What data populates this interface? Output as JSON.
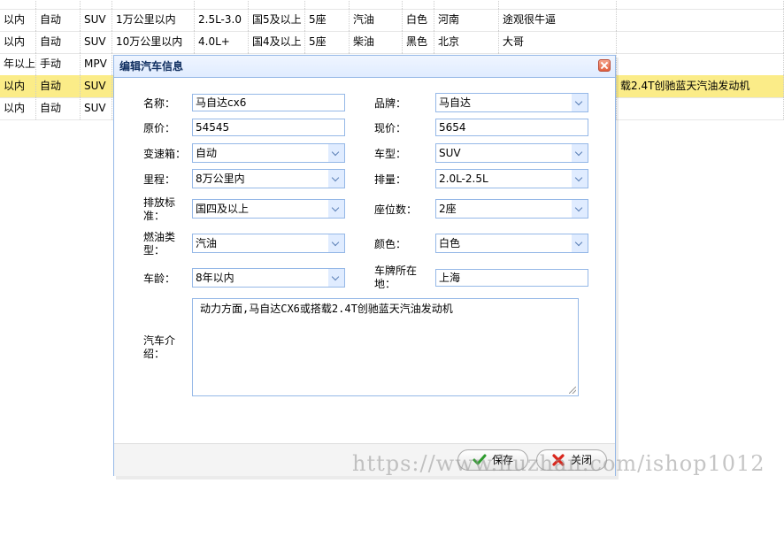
{
  "grid": {
    "rows": [
      {
        "cells": [
          "",
          "",
          "",
          "",
          "",
          "",
          "",
          "",
          "",
          "",
          "",
          ""
        ],
        "selected": false
      },
      {
        "cells": [
          "以内",
          "自动",
          "SUV",
          "1万公里以内",
          "2.5L-3.0",
          "国5及以上",
          "5座",
          "汽油",
          "白色",
          "河南",
          "途观很牛逼",
          ""
        ],
        "selected": false
      },
      {
        "cells": [
          "以内",
          "自动",
          "SUV",
          "10万公里以内",
          "4.0L+",
          "国4及以上",
          "5座",
          "柴油",
          "黑色",
          "北京",
          "大哥",
          ""
        ],
        "selected": false
      },
      {
        "cells": [
          "年以上",
          "手动",
          "MPV",
          "",
          "",
          "",
          "",
          "",
          "",
          "",
          "",
          ""
        ],
        "selected": false
      },
      {
        "cells": [
          "以内",
          "自动",
          "SUV",
          "",
          "",
          "",
          "",
          "",
          "",
          "",
          "",
          "载2.4T创驰蓝天汽油发动机"
        ],
        "selected": true
      },
      {
        "cells": [
          "以内",
          "自动",
          "SUV",
          "",
          "",
          "",
          "",
          "",
          "",
          "",
          "",
          ""
        ],
        "selected": false
      }
    ]
  },
  "dialog": {
    "title": "编辑汽车信息",
    "fields": {
      "name": {
        "label": "名称：",
        "value": "马自达cx6"
      },
      "brand": {
        "label": "品牌：",
        "value": "马自达"
      },
      "original_price": {
        "label": "原价：",
        "value": "54545"
      },
      "current_price": {
        "label": "现价：",
        "value": "5654"
      },
      "gearbox": {
        "label": "变速箱：",
        "value": "自动"
      },
      "car_type": {
        "label": "车型：",
        "value": "SUV"
      },
      "mileage": {
        "label": "里程：",
        "value": "8万公里内"
      },
      "displacement": {
        "label": "排量：",
        "value": "2.0L-2.5L"
      },
      "emission": {
        "label_line1": "排放标",
        "label_line2": "准：",
        "value": "国四及以上"
      },
      "seats": {
        "label": "座位数：",
        "value": "2座"
      },
      "fuel": {
        "label_line1": "燃油类",
        "label_line2": "型：",
        "value": "汽油"
      },
      "color": {
        "label": "颜色：",
        "value": "白色"
      },
      "age": {
        "label": "车龄：",
        "value": "8年以内"
      },
      "plate_location": {
        "label_line1": "车牌所在",
        "label_line2": "地：",
        "value": "上海"
      },
      "description": {
        "label_line1": "汽车介",
        "label_line2": "绍：",
        "value": "动力方面,马自达CX6或搭载2.4T创驰蓝天汽油发动机"
      }
    },
    "buttons": {
      "save": {
        "label": "保存",
        "icon": "check-icon"
      },
      "close": {
        "label": "关闭",
        "icon": "x-icon"
      }
    }
  },
  "watermark": "https://www.huzhan.com/ishop1012",
  "colors": {
    "border": "#95b8e7",
    "selected_row": "#fbec88",
    "header_bg": "#e0ecff"
  }
}
